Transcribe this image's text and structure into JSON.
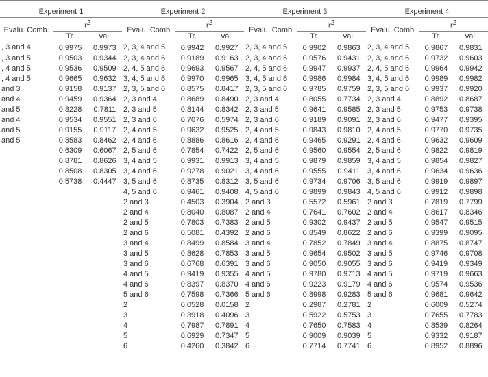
{
  "experiments": [
    {
      "title": "Experiment 1",
      "evalu": "Evalu. Comb.",
      "r2": "r",
      "tr": "Tr.",
      "val": "Val."
    },
    {
      "title": "Experiment 2",
      "evalu": "Evalu. Comb",
      "r2": "r",
      "tr": "Tr.",
      "val": "Val."
    },
    {
      "title": "Experiment 3",
      "evalu": "Evalu. Comb",
      "r2": "r",
      "tr": "Tr.",
      "val": "Val."
    },
    {
      "title": "Experiment 4",
      "evalu": "Evalu. Comb",
      "r2": "r",
      "tr": "Tr.",
      "val": "Val."
    }
  ],
  "chart_data": {
    "type": "table",
    "series": [
      {
        "name": "Experiment 1",
        "rows": [
          {
            "label": ", 3 and 4",
            "tr": "0.9975",
            "val": "0.9973"
          },
          {
            "label": ", 3 and 5",
            "tr": "0.9503",
            "val": "0.9344"
          },
          {
            "label": ", 4 and 5",
            "tr": "0.9536",
            "val": "0.9509"
          },
          {
            "label": ", 4 and 5",
            "tr": "0.9665",
            "val": "0.9632"
          },
          {
            "label": "and 3",
            "tr": "0.9158",
            "val": "0.9137"
          },
          {
            "label": "and 4",
            "tr": "0.9459",
            "val": "0.9364"
          },
          {
            "label": "and 5",
            "tr": "0.8228",
            "val": "0.7811"
          },
          {
            "label": "and 4",
            "tr": "0.9534",
            "val": "0.9551"
          },
          {
            "label": "and 5",
            "tr": "0.9155",
            "val": "0.9117"
          },
          {
            "label": "and 5",
            "tr": "0.8583",
            "val": "0.8462"
          },
          {
            "label": "",
            "tr": "0.6309",
            "val": "0.6067"
          },
          {
            "label": "",
            "tr": "0.8781",
            "val": "0.8626"
          },
          {
            "label": "",
            "tr": "0.8508",
            "val": "0.8305"
          },
          {
            "label": "",
            "tr": "0.5738",
            "val": "0.4447"
          }
        ]
      },
      {
        "name": "Experiment 2",
        "rows": [
          {
            "label": "2, 3, 4 and 5",
            "tr": "0.9942",
            "val": "0.9927"
          },
          {
            "label": "2, 3, 4 and 6",
            "tr": "0.9189",
            "val": "0.9163"
          },
          {
            "label": "2, 4, 5 and 6",
            "tr": "0.9693",
            "val": "0.9567"
          },
          {
            "label": "3, 4, 5 and 6",
            "tr": "0.9970",
            "val": "0.9965"
          },
          {
            "label": "2, 3, 5 and 6",
            "tr": "0.8575",
            "val": "0.8417"
          },
          {
            "label": "2, 3 and 4",
            "tr": "0.8689",
            "val": "0.8490"
          },
          {
            "label": "2, 3 and 5",
            "tr": "0.8144",
            "val": "0.8342"
          },
          {
            "label": "2, 3 and 6",
            "tr": "0.7076",
            "val": "0.5974"
          },
          {
            "label": "2, 4 and 5",
            "tr": "0.9632",
            "val": "0.9525"
          },
          {
            "label": "2, 4 and 6",
            "tr": "0.8886",
            "val": "0.8616"
          },
          {
            "label": "2, 5 and 6",
            "tr": "0.7854",
            "val": "0.7422"
          },
          {
            "label": "3, 4 and 5",
            "tr": "0.9931",
            "val": "0.9913"
          },
          {
            "label": "3, 4 and 6",
            "tr": "0.9278",
            "val": "0.9021"
          },
          {
            "label": "3, 5 and 6",
            "tr": "0.8735",
            "val": "0.8312"
          },
          {
            "label": "4, 5 and 6",
            "tr": "0.9461",
            "val": "0.9408"
          },
          {
            "label": "2 and 3",
            "tr": "0.4503",
            "val": "0.3904"
          },
          {
            "label": "2 and 4",
            "tr": "0.8040",
            "val": "0.8087"
          },
          {
            "label": "2 and 5",
            "tr": "0.7803",
            "val": "0.7383"
          },
          {
            "label": "2 and 6",
            "tr": "0.5081",
            "val": "0.4392"
          },
          {
            "label": "3 and 4",
            "tr": "0.8499",
            "val": "0.8584"
          },
          {
            "label": "3 and 5",
            "tr": "0.8628",
            "val": "0.7853"
          },
          {
            "label": "3 and 6",
            "tr": "0.6768",
            "val": "0.6391"
          },
          {
            "label": "4 and 5",
            "tr": "0.9419",
            "val": "0.9355"
          },
          {
            "label": "4 and 6",
            "tr": "0.8397",
            "val": "0.8370"
          },
          {
            "label": "5 and 6",
            "tr": "0.7598",
            "val": "0.7366"
          },
          {
            "label": "2",
            "tr": "0.0528",
            "val": "0.0158"
          },
          {
            "label": "3",
            "tr": "0.3918",
            "val": "0.4096"
          },
          {
            "label": "4",
            "tr": "0.7987",
            "val": "0.7891"
          },
          {
            "label": "5",
            "tr": "0.6929",
            "val": "0.7347"
          },
          {
            "label": "6",
            "tr": "0.4260",
            "val": "0.3842"
          }
        ]
      },
      {
        "name": "Experiment 3",
        "rows": [
          {
            "label": "2, 3, 4 and 5",
            "tr": "0.9902",
            "val": "0.9863"
          },
          {
            "label": "2, 3, 4 and 6",
            "tr": "0.9576",
            "val": "0.9431"
          },
          {
            "label": "2, 4, 5 and 6",
            "tr": "0.9947",
            "val": "0.9937"
          },
          {
            "label": "3, 4, 5 and 6",
            "tr": "0.9986",
            "val": "0.9984"
          },
          {
            "label": "2, 3, 5 and 6",
            "tr": "0.9785",
            "val": "0.9759"
          },
          {
            "label": "2, 3 and 4",
            "tr": "0.8055",
            "val": "0.7734"
          },
          {
            "label": "2, 3 and 5",
            "tr": "0.9641",
            "val": "0.9585"
          },
          {
            "label": "2, 3 and 6",
            "tr": "0.9189",
            "val": "0.9091"
          },
          {
            "label": "2, 4 and 5",
            "tr": "0.9843",
            "val": "0.9810"
          },
          {
            "label": "2, 4 and 6",
            "tr": "0.9465",
            "val": "0.9291"
          },
          {
            "label": "2, 5 and 6",
            "tr": "0.9560",
            "val": "0.9554"
          },
          {
            "label": "3, 4 and 5",
            "tr": "0.9879",
            "val": "0.9859"
          },
          {
            "label": "3, 4 and 6",
            "tr": "0.9555",
            "val": "0.9411"
          },
          {
            "label": "3, 5 and 6",
            "tr": "0.9734",
            "val": "0.9706"
          },
          {
            "label": "4, 5 and 6",
            "tr": "0.9899",
            "val": "0.9843"
          },
          {
            "label": "2 and 3",
            "tr": "0.5572",
            "val": "0.5961"
          },
          {
            "label": "2 and 4",
            "tr": "0.7641",
            "val": "0.7602"
          },
          {
            "label": "2 and 5",
            "tr": "0.9302",
            "val": "0.9437"
          },
          {
            "label": "2 and 6",
            "tr": "0.8549",
            "val": "0.8622"
          },
          {
            "label": "3 and 4",
            "tr": "0.7852",
            "val": "0.7849"
          },
          {
            "label": "3 and 5",
            "tr": "0.9654",
            "val": "0.9502"
          },
          {
            "label": "3 and 6",
            "tr": "0.9050",
            "val": "0.9055"
          },
          {
            "label": "4 and 5",
            "tr": "0.9780",
            "val": "0.9713"
          },
          {
            "label": "4 and 6",
            "tr": "0.9223",
            "val": "0.9179"
          },
          {
            "label": "5 and 6",
            "tr": "0.8998",
            "val": "0.9283"
          },
          {
            "label": "2",
            "tr": "0.2987",
            "val": "0.2781"
          },
          {
            "label": "3",
            "tr": "0.5922",
            "val": "0.5753"
          },
          {
            "label": "4",
            "tr": "0.7650",
            "val": "0.7583"
          },
          {
            "label": "5",
            "tr": "0.9009",
            "val": "0.9039"
          },
          {
            "label": "6",
            "tr": "0.7714",
            "val": "0.7741"
          }
        ]
      },
      {
        "name": "Experiment 4",
        "rows": [
          {
            "label": "2, 3, 4 and 5",
            "tr": "0.9867",
            "val": "0.9831"
          },
          {
            "label": "2, 3, 4 and 6",
            "tr": "0.9732",
            "val": "0.9603"
          },
          {
            "label": "2, 4, 5 and 6",
            "tr": "0.9964",
            "val": "0.9942"
          },
          {
            "label": "3, 4, 5 and 6",
            "tr": "0.9989",
            "val": "0.9982"
          },
          {
            "label": "2, 3, 5 and 6",
            "tr": "0.9937",
            "val": "0.9920"
          },
          {
            "label": "2, 3 and 4",
            "tr": "0.8892",
            "val": "0.8687"
          },
          {
            "label": "2, 3 and 5",
            "tr": "0.9753",
            "val": "0.9738"
          },
          {
            "label": "2, 3 and 6",
            "tr": "0.9477",
            "val": "0.9395"
          },
          {
            "label": "2, 4 and 5",
            "tr": "0.9770",
            "val": "0.9735"
          },
          {
            "label": "2, 4 and 6",
            "tr": "0.9632",
            "val": "0.9609"
          },
          {
            "label": "2, 5 and 6",
            "tr": "0.9822",
            "val": "0.9819"
          },
          {
            "label": "3, 4 and 5",
            "tr": "0.9854",
            "val": "0.9827"
          },
          {
            "label": "3, 4 and 6",
            "tr": "0.9634",
            "val": "0.9636"
          },
          {
            "label": "3, 5 and 6",
            "tr": "0.9919",
            "val": "0.9897"
          },
          {
            "label": "4, 5 and 6",
            "tr": "0.9912",
            "val": "0.9898"
          },
          {
            "label": "2 and 3",
            "tr": "0.7819",
            "val": "0.7799"
          },
          {
            "label": "2 and 4",
            "tr": "0.8617",
            "val": "0.8346"
          },
          {
            "label": "2 and 5",
            "tr": "0.9547",
            "val": "0.9515"
          },
          {
            "label": "2 and 6",
            "tr": "0.9399",
            "val": "0.9095"
          },
          {
            "label": "3 and 4",
            "tr": "0.8875",
            "val": "0.8747"
          },
          {
            "label": "3 and 5",
            "tr": "0.9746",
            "val": "0.9708"
          },
          {
            "label": "3 and 6",
            "tr": "0.9419",
            "val": "0.9349"
          },
          {
            "label": "4 and 5",
            "tr": "0.9719",
            "val": "0.9663"
          },
          {
            "label": "4 and 6",
            "tr": "0.9574",
            "val": "0.9536"
          },
          {
            "label": "5 and 6",
            "tr": "0.9681",
            "val": "0.9642"
          },
          {
            "label": "2",
            "tr": "0.6009",
            "val": "0.5274"
          },
          {
            "label": "3",
            "tr": "0.7655",
            "val": "0.7783"
          },
          {
            "label": "4",
            "tr": "0.8539",
            "val": "0.8264"
          },
          {
            "label": "5",
            "tr": "0.9332",
            "val": "0.9187"
          },
          {
            "label": "6",
            "tr": "0.8952",
            "val": "0.8896"
          }
        ]
      }
    ]
  }
}
